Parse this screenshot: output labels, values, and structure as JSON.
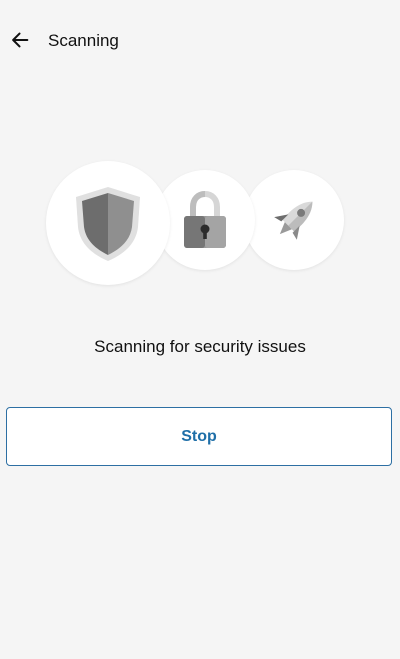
{
  "app_bar": {
    "title": "Scanning",
    "back_icon": "arrow-left-icon"
  },
  "illustration": {
    "icons": [
      "shield-icon",
      "padlock-icon",
      "rocket-icon"
    ]
  },
  "status": {
    "message": "Scanning for security issues"
  },
  "actions": {
    "stop_label": "Stop"
  },
  "colors": {
    "background": "#f5f5f5",
    "accent": "#1f6fa8",
    "button_border": "#2d6fa3",
    "icon_dark": "#6d6d6d",
    "icon_mid": "#9a9a9a",
    "icon_light": "#d8d8d8"
  }
}
